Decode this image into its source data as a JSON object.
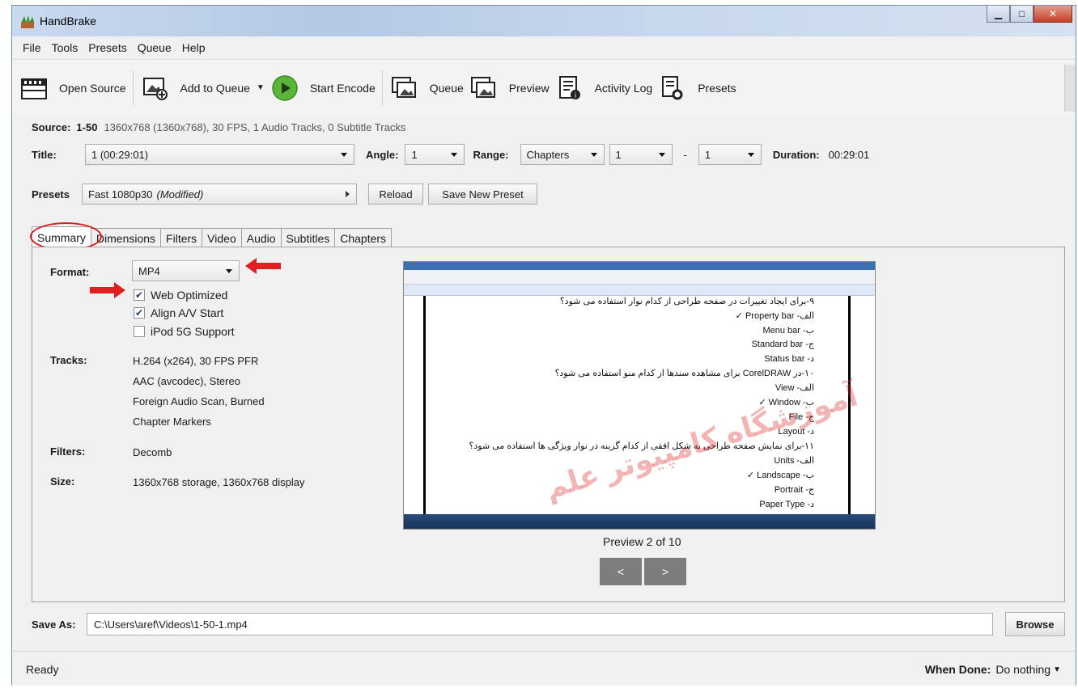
{
  "window": {
    "title": "HandBrake"
  },
  "menu": [
    "File",
    "Tools",
    "Presets",
    "Queue",
    "Help"
  ],
  "toolbar": {
    "open_source": "Open Source",
    "add_to_queue": "Add to Queue",
    "start_encode": "Start Encode",
    "queue": "Queue",
    "preview": "Preview",
    "activity_log": "Activity Log",
    "presets": "Presets"
  },
  "source": {
    "label": "Source:",
    "name": "1-50",
    "details": "1360x768 (1360x768), 30 FPS, 1 Audio Tracks, 0 Subtitle Tracks"
  },
  "title_row": {
    "title_label": "Title:",
    "title_value": "1 (00:29:01)",
    "angle_label": "Angle:",
    "angle_value": "1",
    "range_label": "Range:",
    "range_type": "Chapters",
    "range_start": "1",
    "range_sep": "-",
    "range_end": "1",
    "duration_label": "Duration:",
    "duration_value": "00:29:01"
  },
  "presets_row": {
    "label": "Presets",
    "value": "Fast 1080p30",
    "modified": "(Modified)",
    "reload": "Reload",
    "save_new": "Save New Preset"
  },
  "tabs": [
    "Summary",
    "Dimensions",
    "Filters",
    "Video",
    "Audio",
    "Subtitles",
    "Chapters"
  ],
  "summary": {
    "format_label": "Format:",
    "format_value": "MP4",
    "web_optimized": "Web Optimized",
    "align_av": "Align A/V Start",
    "ipod": "iPod 5G Support",
    "tracks_label": "Tracks:",
    "tracks": [
      "H.264 (x264), 30 FPS PFR",
      "AAC (avcodec), Stereo",
      "Foreign Audio Scan, Burned",
      "Chapter Markers"
    ],
    "filters_label": "Filters:",
    "filters_value": "Decomb",
    "size_label": "Size:",
    "size_value": "1360x768 storage, 1360x768 display"
  },
  "preview_panel": {
    "caption": "Preview 2 of 10",
    "prev": "<",
    "next": ">",
    "lines": [
      "۹-برای ایجاد تغییرات در صفحه طراحی از کدام نوار استفاده می شود؟",
      "الف- Property bar ✓",
      "ب- Menu bar",
      "ج- Standard bar",
      "د- Status bar",
      "۱۰-در CorelDRAW برای مشاهده سندها از کدام منو استفاده می شود؟",
      "الف- View",
      "ب- Window ✓",
      "ج- File",
      "د- Layout",
      "۱۱-برای نمایش صفحه طراحی به شکل افقی از کدام گزینه در نوار ویژگی ها استفاده می شود؟",
      "الف- Units",
      "ب- Landscape ✓",
      "ج- Portrait",
      "د- Paper Type"
    ],
    "watermark": "آموزشگاه کامپیوتر علم"
  },
  "save_as": {
    "label": "Save As:",
    "value": "C:\\Users\\aref\\Videos\\1-50-1.mp4",
    "browse": "Browse"
  },
  "status": {
    "text": "Ready",
    "when_done_label": "When Done:",
    "when_done_value": "Do nothing"
  },
  "colors": {
    "accent_red": "#d81d1d",
    "start_green": "#5bb53a"
  }
}
